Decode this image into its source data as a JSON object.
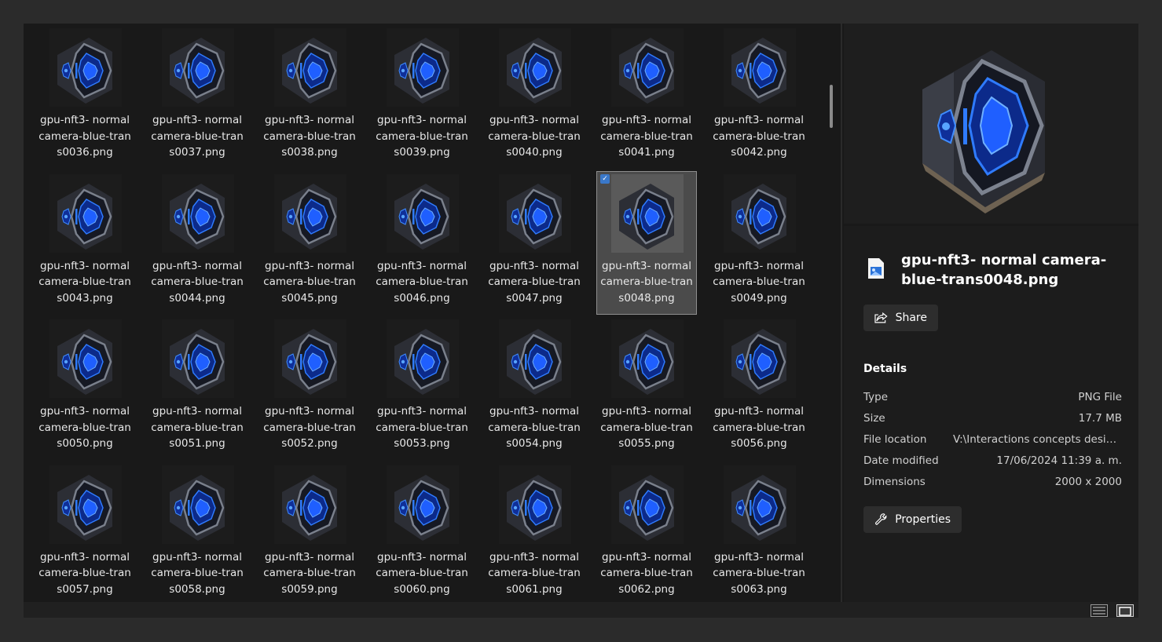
{
  "files": [
    {
      "name": "gpu-nft3- normal\ncamera-blue-tran\ns0036.png"
    },
    {
      "name": "gpu-nft3- normal\ncamera-blue-tran\ns0037.png"
    },
    {
      "name": "gpu-nft3- normal\ncamera-blue-tran\ns0038.png"
    },
    {
      "name": "gpu-nft3- normal\ncamera-blue-tran\ns0039.png"
    },
    {
      "name": "gpu-nft3- normal\ncamera-blue-tran\ns0040.png"
    },
    {
      "name": "gpu-nft3- normal\ncamera-blue-tran\ns0041.png"
    },
    {
      "name": "gpu-nft3- normal\ncamera-blue-tran\ns0042.png"
    },
    {
      "name": "gpu-nft3- normal\ncamera-blue-tran\ns0043.png"
    },
    {
      "name": "gpu-nft3- normal\ncamera-blue-tran\ns0044.png"
    },
    {
      "name": "gpu-nft3- normal\ncamera-blue-tran\ns0045.png"
    },
    {
      "name": "gpu-nft3- normal\ncamera-blue-tran\ns0046.png"
    },
    {
      "name": "gpu-nft3- normal\ncamera-blue-tran\ns0047.png"
    },
    {
      "name": "gpu-nft3- normal\ncamera-blue-tran\ns0048.png",
      "selected": true
    },
    {
      "name": "gpu-nft3- normal\ncamera-blue-tran\ns0049.png"
    },
    {
      "name": "gpu-nft3- normal\ncamera-blue-tran\ns0050.png"
    },
    {
      "name": "gpu-nft3- normal\ncamera-blue-tran\ns0051.png"
    },
    {
      "name": "gpu-nft3- normal\ncamera-blue-tran\ns0052.png"
    },
    {
      "name": "gpu-nft3- normal\ncamera-blue-tran\ns0053.png"
    },
    {
      "name": "gpu-nft3- normal\ncamera-blue-tran\ns0054.png"
    },
    {
      "name": "gpu-nft3- normal\ncamera-blue-tran\ns0055.png"
    },
    {
      "name": "gpu-nft3- normal\ncamera-blue-tran\ns0056.png"
    },
    {
      "name": "gpu-nft3- normal\ncamera-blue-tran\ns0057.png"
    },
    {
      "name": "gpu-nft3- normal\ncamera-blue-tran\ns0058.png"
    },
    {
      "name": "gpu-nft3- normal\ncamera-blue-tran\ns0059.png"
    },
    {
      "name": "gpu-nft3- normal\ncamera-blue-tran\ns0060.png"
    },
    {
      "name": "gpu-nft3- normal\ncamera-blue-tran\ns0061.png"
    },
    {
      "name": "gpu-nft3- normal\ncamera-blue-tran\ns0062.png"
    },
    {
      "name": "gpu-nft3- normal\ncamera-blue-tran\ns0063.png"
    }
  ],
  "details_pane": {
    "file_title": "gpu-nft3- normal camera-blue-trans0048.png",
    "share_label": "Share",
    "details_heading": "Details",
    "rows": [
      {
        "key": "Type",
        "value": "PNG File"
      },
      {
        "key": "Size",
        "value": "17.7 MB"
      },
      {
        "key": "File location",
        "value": "V:\\Interactions concepts desig..."
      },
      {
        "key": "Date modified",
        "value": "17/06/2024 11:39 a. m."
      },
      {
        "key": "Dimensions",
        "value": "2000 x 2000"
      }
    ],
    "properties_label": "Properties"
  },
  "icons": {
    "file": "image-file-icon",
    "share": "share-icon",
    "properties": "wrench-icon",
    "details_view": "details-view-icon",
    "tiles_view": "large-icons-view-icon"
  },
  "colors": {
    "background": "#191919",
    "selection": "#4b4b4b",
    "accent_blue": "#2f7bff"
  }
}
